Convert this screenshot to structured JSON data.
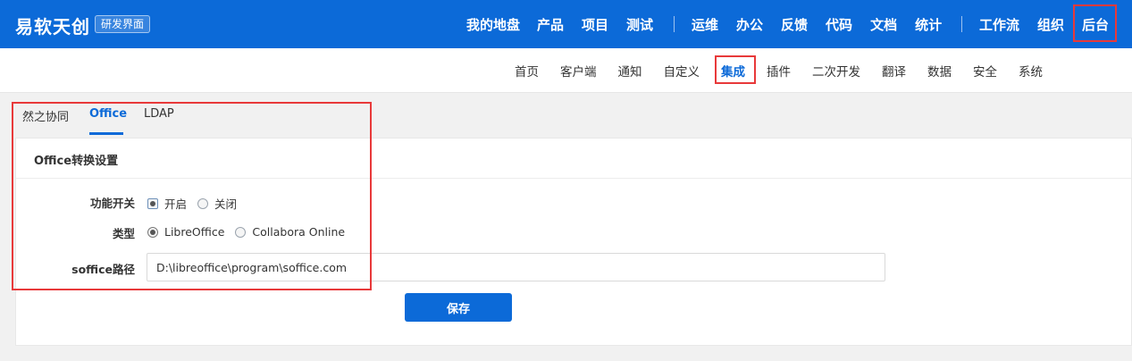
{
  "brand": {
    "name": "易软天创",
    "badge": "研发界面"
  },
  "top_nav": {
    "group1": [
      "我的地盘",
      "产品",
      "项目",
      "测试"
    ],
    "group2": [
      "运维",
      "办公",
      "反馈",
      "代码",
      "文档",
      "统计"
    ],
    "group3": [
      "工作流",
      "组织",
      "后台"
    ],
    "active": "后台"
  },
  "sub_nav": {
    "items": [
      "首页",
      "客户端",
      "通知",
      "自定义",
      "集成",
      "插件",
      "二次开发",
      "翻译",
      "数据",
      "安全",
      "系统"
    ],
    "active": "集成"
  },
  "tabs": {
    "items": [
      "然之协同",
      "Office",
      "LDAP"
    ],
    "active": "Office"
  },
  "card": {
    "title": "Office转换设置",
    "feature_switch": {
      "label": "功能开关",
      "options": [
        "开启",
        "关闭"
      ],
      "selected": "开启"
    },
    "type": {
      "label": "类型",
      "options": [
        "LibreOffice",
        "Collabora Online"
      ],
      "selected": "LibreOffice"
    },
    "soffice_path": {
      "label": "soffice路径",
      "value": "D:\\libreoffice\\program\\soffice.com"
    },
    "save_label": "保存"
  },
  "colors": {
    "primary": "#0c6ad8",
    "highlight": "#e8393a"
  }
}
